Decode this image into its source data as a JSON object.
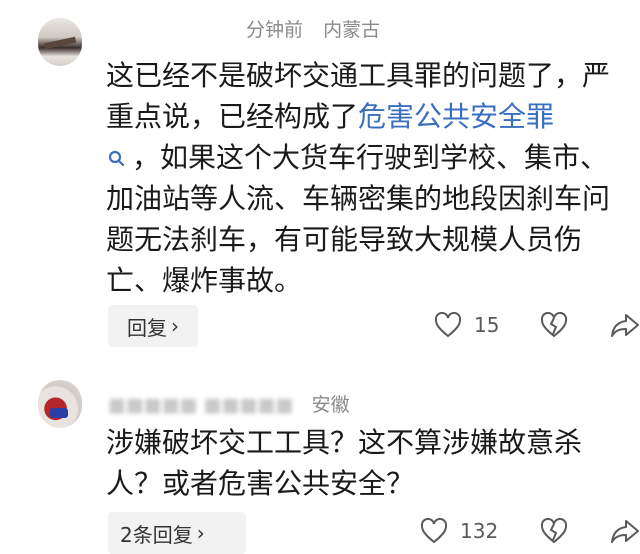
{
  "comments": [
    {
      "author": "",
      "time": "分钟前",
      "location": "内蒙古",
      "text_before": "这已经不是破坏交通工具罪的问题了，严重点说，已经构成了",
      "link": "危害公共安全罪",
      "text_after": "，如果这个大货车行驶到学校、集市、加油站等人流、车辆密集的地段因刹车问题无法刹车，有可能导致大规模人员伤亡、爆炸事故。",
      "reply_label": "回复",
      "likes": "15"
    },
    {
      "author": "",
      "time": "",
      "location": "安徽",
      "text": "涉嫌破坏交工工具？这不算涉嫌故意杀人？或者危害公共安全？",
      "reply_label": "2条回复",
      "likes": "132"
    }
  ],
  "icons": {
    "like": "heart-icon",
    "dislike": "broken-heart-icon",
    "share": "share-icon",
    "search": "search-icon",
    "chevron": "chevron-right-icon"
  }
}
